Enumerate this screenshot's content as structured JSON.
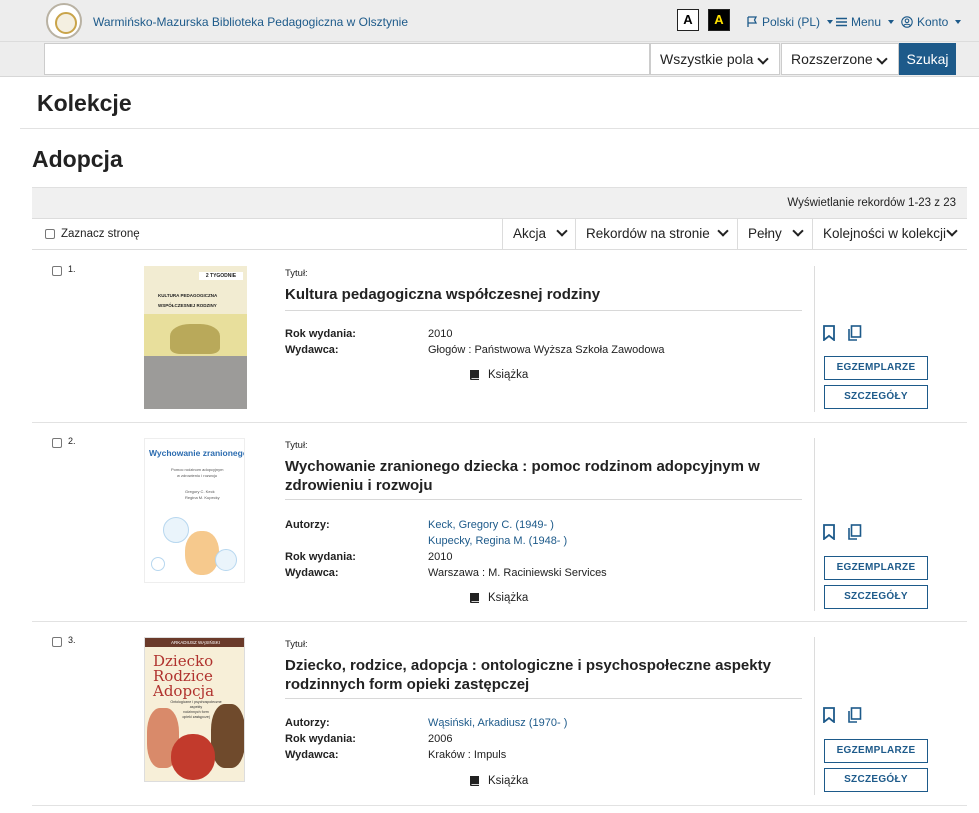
{
  "header": {
    "site_title": "Warmińsko-Mazurska Biblioteka Pedagogiczna w Olsztynie",
    "contrast_normal": "A",
    "contrast_high": "A",
    "language": "Polski (PL)",
    "menu": "Menu",
    "account": "Konto"
  },
  "search": {
    "placeholder": "",
    "field_select": "Wszystkie pola",
    "mode_select": "Rozszerzone",
    "submit": "Szukaj"
  },
  "page": {
    "section_title": "Kolekcje",
    "collection_title": "Adopcja",
    "records_info": "Wyświetlanie rekordów 1-23 z 23"
  },
  "toolbar": {
    "select_page": "Zaznacz stronę",
    "action": "Akcja",
    "per_page": "Rekordów na stronie",
    "view": "Pełny",
    "sort": "Kolejności w kolekcji"
  },
  "labels": {
    "title": "Tytuł:",
    "authors": "Autorzy:",
    "year": "Rok wydania:",
    "publisher": "Wydawca:",
    "copies_button": "EGZEMPLARZE",
    "details_button": "SZCZEGÓŁY"
  },
  "records": [
    {
      "number": "1.",
      "title": "Kultura pedagogiczna współczesnej rodziny",
      "authors": [],
      "year": "2010",
      "publisher": "Głogów : Państwowa Wyższa Szkoła Zawodowa",
      "format": "Książka",
      "cover_text": [
        "2 TYGODNIE",
        "KULTURA PEDAGOGICZNA",
        "WSPÓŁCZESNEJ RODZINY"
      ]
    },
    {
      "number": "2.",
      "title": "Wychowanie zranionego dziecka : pomoc rodzinom adopcyjnym w zdrowieniu i rozwoju",
      "authors": [
        "Keck, Gregory C. (1949- )",
        "Kupecky, Regina M. (1948- )"
      ],
      "year": "2010",
      "publisher": "Warszawa : M. Raciniewski Services",
      "format": "Książka",
      "cover_text": [
        "Wychowanie zranionego dziecka",
        "Pomoc rodzinom adopcyjnym",
        "w zdrowieniu i rozwoju",
        "Gregory C. Keck",
        "Regina M. Kupecky"
      ]
    },
    {
      "number": "3.",
      "title": "Dziecko, rodzice, adopcja : ontologiczne i psychospołeczne aspekty rodzinnych form opieki zastępczej",
      "authors": [
        "Wąsiński, Arkadiusz (1970- )"
      ],
      "year": "2006",
      "publisher": "Kraków : Impuls",
      "format": "Książka",
      "cover_text": [
        "ARKADIUSZ WĄSIŃSKI",
        "Dziecko",
        "Rodzice",
        "Adopcja",
        "Ontologiczne i psychospołeczne",
        "aspekty",
        "rodzinnych form",
        "opieki zastępczej"
      ]
    }
  ],
  "colors": {
    "link": "#1d5a8a",
    "header_bg": "#ededed",
    "search_button": "#1d5a8a"
  }
}
